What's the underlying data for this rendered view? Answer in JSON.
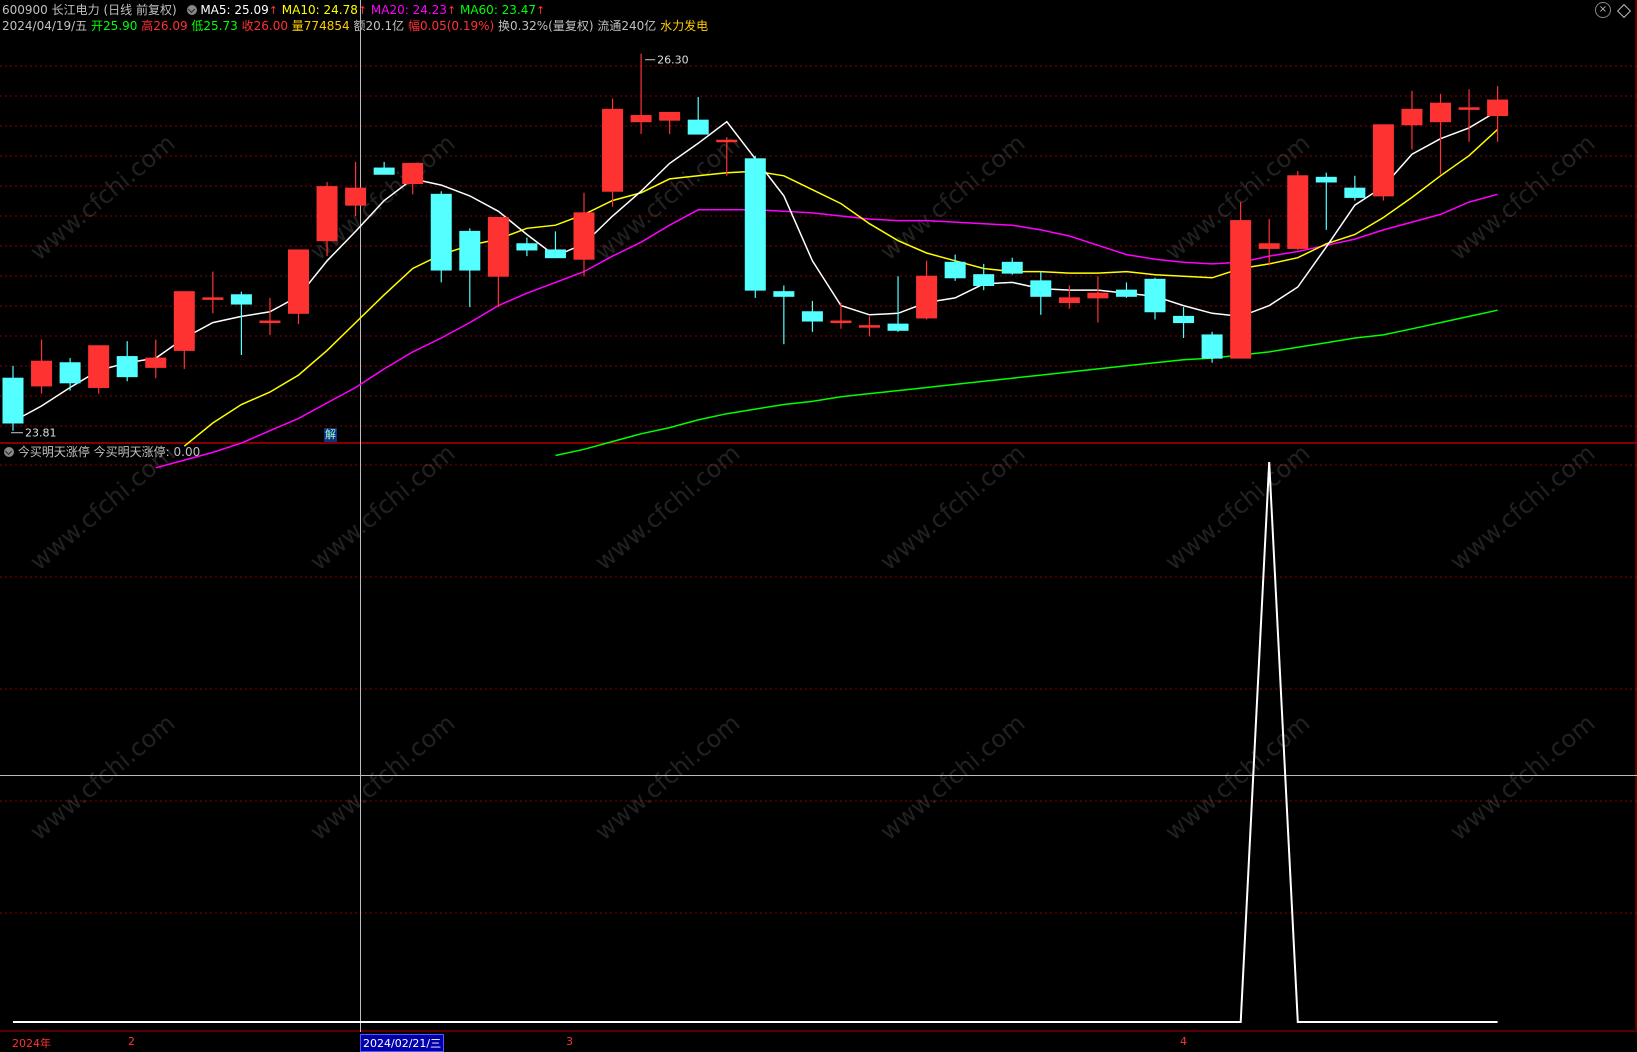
{
  "header": {
    "code": "600900",
    "name": "长江电力",
    "mode": "(日线 前复权)",
    "ma5_label": "MA5: 25.09",
    "ma10_label": "MA10: 24.78",
    "ma20_label": "MA20: 24.23",
    "ma60_label": "MA60: 23.47",
    "up_arrow": "↑",
    "date": "2024/04/19/五",
    "open": "开25.90",
    "high": "高26.09",
    "low": "低25.73",
    "close": "收26.00",
    "volume": "量774854",
    "amount": "额20.1亿",
    "change_label": "幅",
    "change_value": "0.05(0.19%)",
    "turnover": "换0.32%(量复权)",
    "float_cap": "流通240亿",
    "sector": "水力发电"
  },
  "indicator": {
    "name": "今买明天涨停",
    "value_label": "今买明天涨停: 0.00"
  },
  "annotations": {
    "high_mark": "26.30",
    "low_mark": "23.81",
    "jie_badge": "解"
  },
  "x_axis": {
    "year": "2024年",
    "month2": "2",
    "cursor_date": "2024/02/21/三",
    "month3": "3",
    "month4": "4"
  },
  "watermark": "www.cfchi.com",
  "colors": {
    "up": "#ff3232",
    "down": "#54ffff",
    "ma5": "#ffffff",
    "ma10": "#ffff00",
    "ma20": "#ff00ff",
    "ma60": "#00ff00",
    "grid": "#8b0000",
    "indicator": "#ffffff"
  },
  "chart_data": {
    "type": "candlestick",
    "price_range": [
      23.8,
      26.35
    ],
    "candles": [
      {
        "o": 24.2,
        "h": 24.28,
        "l": 23.86,
        "c": 23.91
      },
      {
        "o": 24.15,
        "h": 24.45,
        "l": 24.1,
        "c": 24.31
      },
      {
        "o": 24.3,
        "h": 24.33,
        "l": 24.12,
        "c": 24.17
      },
      {
        "o": 24.14,
        "h": 24.34,
        "l": 24.1,
        "c": 24.41
      },
      {
        "o": 24.34,
        "h": 24.44,
        "l": 24.18,
        "c": 24.21
      },
      {
        "o": 24.27,
        "h": 24.45,
        "l": 24.2,
        "c": 24.33
      },
      {
        "o": 24.38,
        "h": 24.57,
        "l": 24.26,
        "c": 24.76
      },
      {
        "o": 24.71,
        "h": 24.89,
        "l": 24.62,
        "c": 24.72
      },
      {
        "o": 24.74,
        "h": 24.76,
        "l": 24.35,
        "c": 24.68
      },
      {
        "o": 24.56,
        "h": 24.72,
        "l": 24.48,
        "c": 24.57
      },
      {
        "o": 24.62,
        "h": 24.99,
        "l": 24.55,
        "c": 25.03
      },
      {
        "o": 25.09,
        "h": 25.47,
        "l": 24.99,
        "c": 25.44
      },
      {
        "o": 25.32,
        "h": 25.6,
        "l": 25.25,
        "c": 25.43
      },
      {
        "o": 25.56,
        "h": 25.6,
        "l": 25.52,
        "c": 25.52
      },
      {
        "o": 25.46,
        "h": 25.53,
        "l": 25.39,
        "c": 25.59
      },
      {
        "o": 25.39,
        "h": 25.41,
        "l": 24.82,
        "c": 24.9
      },
      {
        "o": 25.15,
        "h": 25.17,
        "l": 24.66,
        "c": 24.9
      },
      {
        "o": 24.86,
        "h": 25.24,
        "l": 24.66,
        "c": 25.24
      },
      {
        "o": 25.07,
        "h": 25.11,
        "l": 24.99,
        "c": 25.03
      },
      {
        "o": 25.03,
        "h": 25.15,
        "l": 24.98,
        "c": 24.98
      },
      {
        "o": 24.97,
        "h": 25.4,
        "l": 24.86,
        "c": 25.27
      },
      {
        "o": 25.41,
        "h": 26.01,
        "l": 25.31,
        "c": 25.94
      },
      {
        "o": 25.86,
        "h": 26.3,
        "l": 25.78,
        "c": 25.9
      },
      {
        "o": 25.87,
        "h": 25.9,
        "l": 25.78,
        "c": 25.92
      },
      {
        "o": 25.87,
        "h": 26.02,
        "l": 25.79,
        "c": 25.78
      },
      {
        "o": 25.74,
        "h": 25.76,
        "l": 25.51,
        "c": 25.74
      },
      {
        "o": 25.62,
        "h": 25.64,
        "l": 24.72,
        "c": 24.77
      },
      {
        "o": 24.76,
        "h": 24.8,
        "l": 24.42,
        "c": 24.73
      },
      {
        "o": 24.63,
        "h": 24.7,
        "l": 24.5,
        "c": 24.57
      },
      {
        "o": 24.56,
        "h": 24.69,
        "l": 24.52,
        "c": 24.57
      },
      {
        "o": 24.54,
        "h": 24.6,
        "l": 24.47,
        "c": 24.54
      },
      {
        "o": 24.55,
        "h": 24.86,
        "l": 24.5,
        "c": 24.51
      },
      {
        "o": 24.59,
        "h": 24.96,
        "l": 24.58,
        "c": 24.86
      },
      {
        "o": 24.95,
        "h": 25.0,
        "l": 24.83,
        "c": 24.85
      },
      {
        "o": 24.87,
        "h": 24.94,
        "l": 24.77,
        "c": 24.8
      },
      {
        "o": 24.95,
        "h": 24.98,
        "l": 24.87,
        "c": 24.88
      },
      {
        "o": 24.83,
        "h": 24.89,
        "l": 24.61,
        "c": 24.73
      },
      {
        "o": 24.69,
        "h": 24.8,
        "l": 24.65,
        "c": 24.72
      },
      {
        "o": 24.72,
        "h": 24.86,
        "l": 24.56,
        "c": 24.75
      },
      {
        "o": 24.77,
        "h": 24.82,
        "l": 24.72,
        "c": 24.73
      },
      {
        "o": 24.84,
        "h": 24.85,
        "l": 24.58,
        "c": 24.63
      },
      {
        "o": 24.6,
        "h": 24.66,
        "l": 24.46,
        "c": 24.56
      },
      {
        "o": 24.48,
        "h": 24.5,
        "l": 24.3,
        "c": 24.33
      },
      {
        "o": 24.33,
        "h": 25.34,
        "l": 24.34,
        "c": 25.22
      },
      {
        "o": 25.04,
        "h": 25.23,
        "l": 24.93,
        "c": 25.07
      },
      {
        "o": 25.04,
        "h": 25.54,
        "l": 25.03,
        "c": 25.51
      },
      {
        "o": 25.5,
        "h": 25.53,
        "l": 25.16,
        "c": 25.47
      },
      {
        "o": 25.43,
        "h": 25.51,
        "l": 25.35,
        "c": 25.37
      },
      {
        "o": 25.38,
        "h": 25.8,
        "l": 25.35,
        "c": 25.84
      },
      {
        "o": 25.84,
        "h": 26.06,
        "l": 25.68,
        "c": 25.94
      },
      {
        "o": 25.86,
        "h": 26.04,
        "l": 25.52,
        "c": 25.98
      },
      {
        "o": 25.94,
        "h": 26.07,
        "l": 25.73,
        "c": 25.95
      },
      {
        "o": 25.9,
        "h": 26.09,
        "l": 25.73,
        "c": 26.0
      }
    ],
    "ma5": [
      23.92,
      24.02,
      24.14,
      24.25,
      24.3,
      24.33,
      24.46,
      24.56,
      24.6,
      24.63,
      24.73,
      24.96,
      25.15,
      25.35,
      25.49,
      25.45,
      25.38,
      25.28,
      25.13,
      24.99,
      25.07,
      25.25,
      25.41,
      25.59,
      25.72,
      25.86,
      25.62,
      25.38,
      24.96,
      24.67,
      24.61,
      24.62,
      24.69,
      24.72,
      24.81,
      24.82,
      24.78,
      24.77,
      24.77,
      24.75,
      24.73,
      24.67,
      24.62,
      24.6,
      24.67,
      24.79,
      25.05,
      25.32,
      25.44,
      25.65,
      25.75,
      25.82,
      25.93
    ],
    "ma10": [
      null,
      null,
      null,
      null,
      null,
      null,
      23.76,
      23.91,
      24.03,
      24.11,
      24.22,
      24.38,
      24.56,
      24.74,
      24.91,
      25.0,
      25.06,
      25.1,
      25.17,
      25.19,
      25.26,
      25.35,
      25.4,
      25.49,
      25.51,
      25.53,
      25.54,
      25.51,
      25.42,
      25.33,
      25.2,
      25.09,
      25.01,
      24.96,
      24.91,
      24.89,
      24.89,
      24.88,
      24.88,
      24.89,
      24.87,
      24.86,
      24.85,
      24.91,
      24.94,
      24.98,
      25.07,
      25.13,
      25.24,
      25.37,
      25.51,
      25.64,
      25.81
    ],
    "ma20": [
      null,
      null,
      null,
      null,
      null,
      23.62,
      23.67,
      23.72,
      23.78,
      23.86,
      23.94,
      24.04,
      24.14,
      24.26,
      24.37,
      24.46,
      24.56,
      24.67,
      24.75,
      24.82,
      24.89,
      24.99,
      25.08,
      25.19,
      25.29,
      25.29,
      25.29,
      25.28,
      25.27,
      25.25,
      25.23,
      25.22,
      25.22,
      25.21,
      25.2,
      25.19,
      25.16,
      25.12,
      25.06,
      25.0,
      24.97,
      24.95,
      24.94,
      24.95,
      24.99,
      25.02,
      25.06,
      25.1,
      25.16,
      25.21,
      25.26,
      25.34,
      25.39
    ],
    "ma60": [
      null,
      null,
      null,
      null,
      null,
      null,
      null,
      null,
      null,
      null,
      null,
      null,
      null,
      null,
      null,
      null,
      null,
      null,
      null,
      23.7,
      23.74,
      23.79,
      23.84,
      23.88,
      23.93,
      23.97,
      24.0,
      24.03,
      24.05,
      24.08,
      24.1,
      24.12,
      24.14,
      24.16,
      24.18,
      24.2,
      24.22,
      24.24,
      24.26,
      24.28,
      24.3,
      24.32,
      24.33,
      24.35,
      24.37,
      24.4,
      24.43,
      24.46,
      24.48,
      24.52,
      24.56,
      24.6,
      24.64
    ],
    "indicator_range": [
      0,
      1
    ],
    "indicator": [
      0,
      0,
      0,
      0,
      0,
      0,
      0,
      0,
      0,
      0,
      0,
      0,
      0,
      0,
      0,
      0,
      0,
      0,
      0,
      0,
      0,
      0,
      0,
      0,
      0,
      0,
      0,
      0,
      0,
      0,
      0,
      0,
      0,
      0,
      0,
      0,
      0,
      0,
      0,
      0,
      0,
      0,
      0,
      0,
      1,
      0,
      0,
      0,
      0,
      0,
      0,
      0,
      0
    ]
  }
}
